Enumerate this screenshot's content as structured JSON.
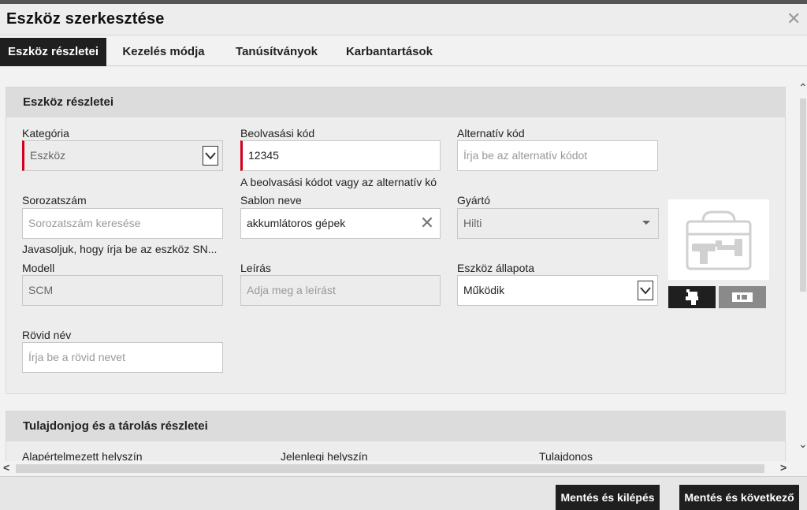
{
  "window": {
    "title": "Eszköz szerkesztése"
  },
  "tabs": [
    {
      "label": "Eszköz részletei",
      "active": true
    },
    {
      "label": "Kezelés módja"
    },
    {
      "label": "Tanúsítványok"
    },
    {
      "label": "Karbantartások"
    }
  ],
  "details": {
    "heading": "Eszköz részletei",
    "category": {
      "label": "Kategória",
      "value": "Eszköz"
    },
    "scan_code": {
      "label": "Beolvasási kód",
      "value": "12345",
      "hint": "A beolvasási kódot vagy az alternatív kó"
    },
    "alt_code": {
      "label": "Alternatív kód",
      "placeholder": "Írja be az alternatív kódot"
    },
    "serial": {
      "label": "Sorozatszám",
      "placeholder": "Sorozatszám keresése",
      "hint": "Javasoljuk, hogy írja be az eszköz SN..."
    },
    "template": {
      "label": "Sablon neve",
      "value": "akkumlátoros gépek"
    },
    "manufacturer": {
      "label": "Gyártó",
      "value": "Hilti"
    },
    "model": {
      "label": "Modell",
      "value": "SCM"
    },
    "description": {
      "label": "Leírás",
      "placeholder": "Adja meg a leírást"
    },
    "status": {
      "label": "Eszköz állapota",
      "value": "Működik"
    },
    "short_name": {
      "label": "Rövid név",
      "placeholder": "Írja be a rövid nevet"
    }
  },
  "ownership": {
    "heading": "Tulajdonjog és a tárolás részletei",
    "default_location": "Alapértelmezett helyszín",
    "current_location": "Jelenlegi helyszín",
    "owner": "Tulajdonos"
  },
  "footer": {
    "save_exit": "Mentés és kilépés",
    "save_next": "Mentés és következő"
  },
  "colors": {
    "accent_required": "#d2001e",
    "active_tab": "#1f1f1f"
  }
}
